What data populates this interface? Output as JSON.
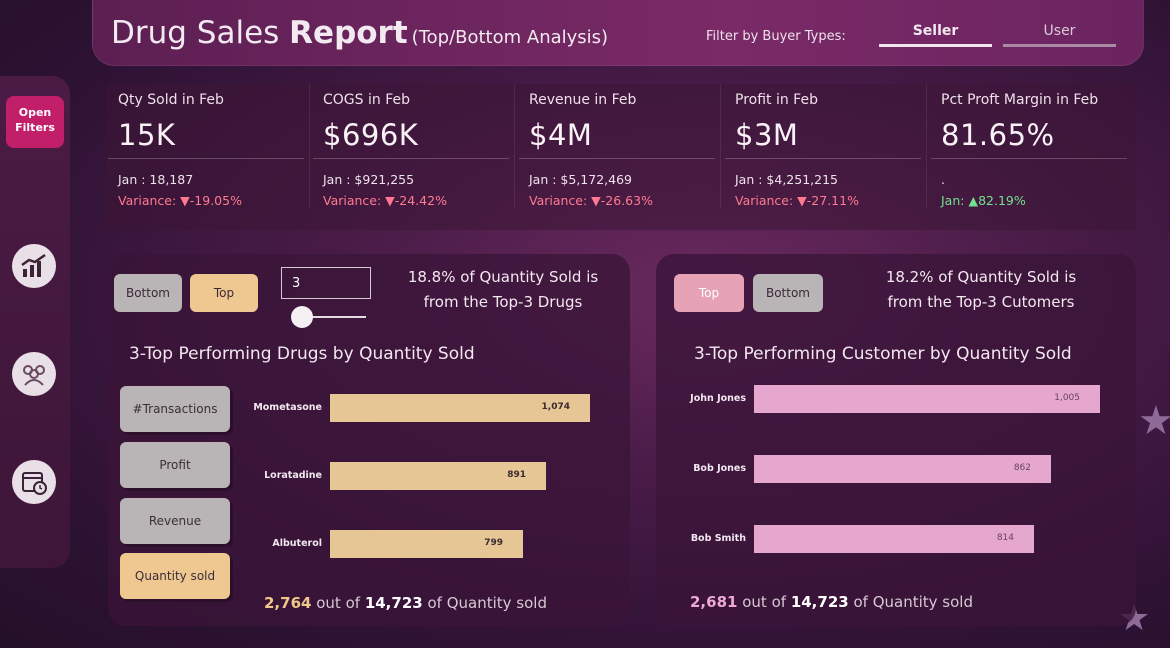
{
  "header": {
    "title_light": "Drug Sales",
    "title_bold": "Report",
    "subtitle": "(Top/Bottom Analysis)",
    "filter_label": "Filter by Buyer Types:",
    "buyer_types": [
      "Seller",
      "User"
    ],
    "selected_buyer_type": "Seller"
  },
  "sidebar": {
    "open_filters_line1": "Open",
    "open_filters_line2": "Filters",
    "icons": [
      "chart-growth-icon",
      "people-group-icon",
      "calendar-clock-icon"
    ]
  },
  "kpis": [
    {
      "label": "Qty Sold in Feb",
      "value": "15K",
      "prev": "Jan : 18,187",
      "variance": "Variance: ▼-19.05%",
      "direction": "down"
    },
    {
      "label": "COGS in Feb",
      "value": "$696K",
      "prev": "Jan : $921,255",
      "variance": "Variance: ▼-24.42%",
      "direction": "down"
    },
    {
      "label": "Revenue in Feb",
      "value": "$4M",
      "prev": "Jan : $5,172,469",
      "variance": "Variance: ▼-26.63%",
      "direction": "down"
    },
    {
      "label": "Profit in Feb",
      "value": "$3M",
      "prev": "Jan : $4,251,215",
      "variance": "Variance: ▼-27.11%",
      "direction": "down"
    },
    {
      "label": "Pct Proft Margin in Feb",
      "value": "81.65%",
      "prev": ".",
      "variance": "Jan: ▲82.19%",
      "direction": "up"
    }
  ],
  "left_panel": {
    "bottom_button": "Bottom",
    "top_button": "Top",
    "top_n_value": "3",
    "insight_line1": "18.8% of Quantity Sold is",
    "insight_line2": "from the Top-3 Drugs",
    "chart_title": "3-Top Performing Drugs by Quantity Sold",
    "metric_buttons": [
      "#Transactions",
      "Profit",
      "Revenue",
      "Quantity sold"
    ],
    "selected_metric": "Quantity sold",
    "footer": {
      "part": "2,764",
      "mid": "out of",
      "total": "14,723",
      "suffix": "of Quantity sold"
    }
  },
  "right_panel": {
    "top_button": "Top",
    "bottom_button": "Bottom",
    "insight_line1": "18.2% of Quantity Sold is",
    "insight_line2": "from the Top-3 Cutomers",
    "chart_title": "3-Top Performing Customer by Quantity Sold",
    "footer": {
      "part": "2,681",
      "mid": "out of",
      "total": "14,723",
      "suffix": "of Quantity sold"
    }
  },
  "chart_data": [
    {
      "type": "bar",
      "orientation": "horizontal",
      "title": "3-Top Performing Drugs by Quantity Sold",
      "categories": [
        "Mometasone",
        "Loratadine",
        "Albuterol"
      ],
      "values": [
        1074,
        891,
        799
      ],
      "value_labels": [
        "1,074",
        "891",
        "799"
      ],
      "color": "#e6c694"
    },
    {
      "type": "bar",
      "orientation": "horizontal",
      "title": "3-Top Performing Customer by Quantity Sold",
      "categories": [
        "John Jones",
        "Bob Jones",
        "Bob Smith"
      ],
      "values": [
        1005,
        862,
        814
      ],
      "value_labels": [
        "1,005",
        "862",
        "814"
      ],
      "color": "#e6a7cf"
    }
  ]
}
